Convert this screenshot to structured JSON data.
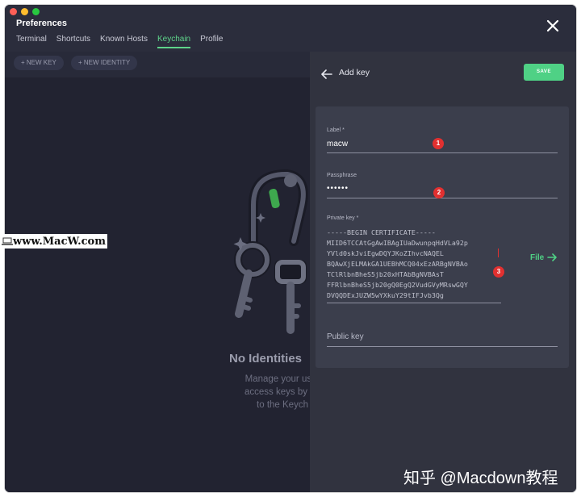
{
  "window": {
    "title": "Preferences",
    "tabs": [
      {
        "label": "Terminal"
      },
      {
        "label": "Shortcuts"
      },
      {
        "label": "Known Hosts"
      },
      {
        "label": "Keychain",
        "active": true
      },
      {
        "label": "Profile"
      }
    ]
  },
  "toolbar": {
    "new_key_label": "+ NEW KEY",
    "new_identity_label": "+ NEW IDENTITY"
  },
  "empty_state": {
    "title": "No Identities",
    "desc_line1": "Manage your user",
    "desc_line2": "access keys by ad",
    "desc_line3": "to the Keych"
  },
  "panel": {
    "title": "Add key",
    "save_label": "SAVE",
    "label_field": {
      "label": "Label *",
      "value": "macw",
      "badge": "1"
    },
    "passphrase_field": {
      "label": "Passphrase",
      "value": "••••••",
      "badge": "2"
    },
    "private_key_field": {
      "label": "Private key *",
      "value": "-----BEGIN CERTIFICATE-----\nMIID6TCCAtGgAwIBAgIUaDwunpqHdVLa92p\nYVld0skJviEgwDQYJKoZIhvcNAQEL\nBQAwXjELMAkGA1UEBhMCQ04xEzARBgNVBAo\nTClRlbnBheS5jb20xHTAbBgNVBAsT\nFFRlbnBheS5jb20gQ0EgQ2VudGVyMRswGQY\nDVQQDExJUZW5wYXkuY29tIFJvb3Qg",
      "badge": "3"
    },
    "file_label": "File",
    "public_key_placeholder": "Public key"
  },
  "watermarks": {
    "left": "www.MacW.com",
    "bottom": "知乎 @Macdown教程"
  },
  "colors": {
    "accent": "#5ed48a",
    "save": "#4fd185",
    "badge": "#e23030",
    "window_bg": "#2b2d3c"
  }
}
